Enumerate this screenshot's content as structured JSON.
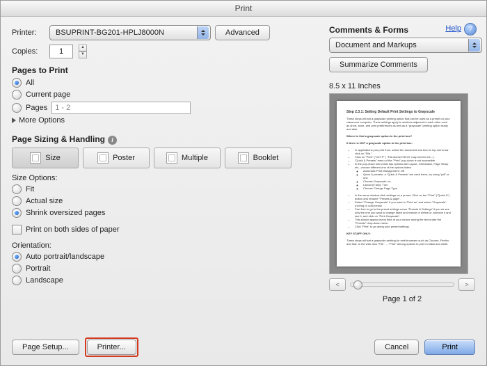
{
  "title": "Print",
  "help": "Help",
  "printer": {
    "label": "Printer:",
    "value": "BSUPRINT-BG201-HPLJ8000N",
    "advanced": "Advanced"
  },
  "copies": {
    "label": "Copies:",
    "value": "1"
  },
  "pages": {
    "heading": "Pages to Print",
    "all": "All",
    "current": "Current page",
    "pages": "Pages",
    "range": "1 - 2",
    "more": "More Options"
  },
  "size": {
    "heading": "Page Sizing & Handling",
    "size": "Size",
    "poster": "Poster",
    "multiple": "Multiple",
    "booklet": "Booklet",
    "options_label": "Size Options:",
    "fit": "Fit",
    "actual": "Actual size",
    "shrink": "Shrink oversized pages",
    "duplex": "Print on both sides of paper"
  },
  "orientation": {
    "heading": "Orientation:",
    "auto": "Auto portrait/landscape",
    "portrait": "Portrait",
    "landscape": "Landscape"
  },
  "comments": {
    "heading": "Comments & Forms",
    "value": "Document and Markups",
    "summarize": "Summarize Comments"
  },
  "preview": {
    "dims": "8.5 x 11 Inches",
    "page": "Page 1 of 2"
  },
  "footer": {
    "page_setup": "Page Setup...",
    "printer_btn": "Printer...",
    "cancel": "Cancel",
    "print": "Print"
  }
}
